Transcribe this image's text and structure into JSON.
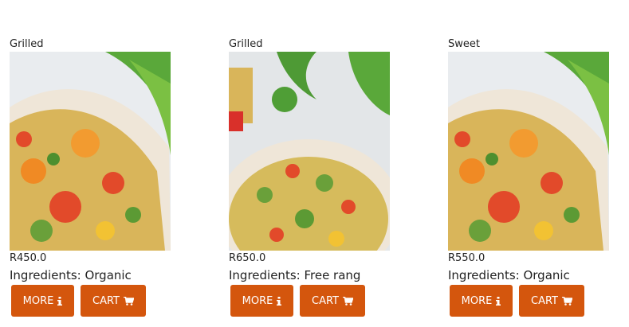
{
  "products": [
    {
      "category": "Grilled",
      "price": "R450.0",
      "ingredients": "Ingredients: Organic",
      "more_label": "MORE",
      "cart_label": "CART",
      "image_variant": "salad-closeup"
    },
    {
      "category": "Grilled",
      "price": "R650.0",
      "ingredients": "Ingredients: Free rang",
      "more_label": "MORE",
      "cart_label": "CART",
      "image_variant": "salad-bowl"
    },
    {
      "category": "Sweet",
      "price": "R550.0",
      "ingredients": "Ingredients: Organic",
      "more_label": "MORE",
      "cart_label": "CART",
      "image_variant": "salad-closeup"
    }
  ],
  "colors": {
    "button": "#d4560d",
    "button_text": "#ffffff"
  },
  "icons": {
    "more": "info-icon",
    "cart": "shopping-cart-icon"
  }
}
